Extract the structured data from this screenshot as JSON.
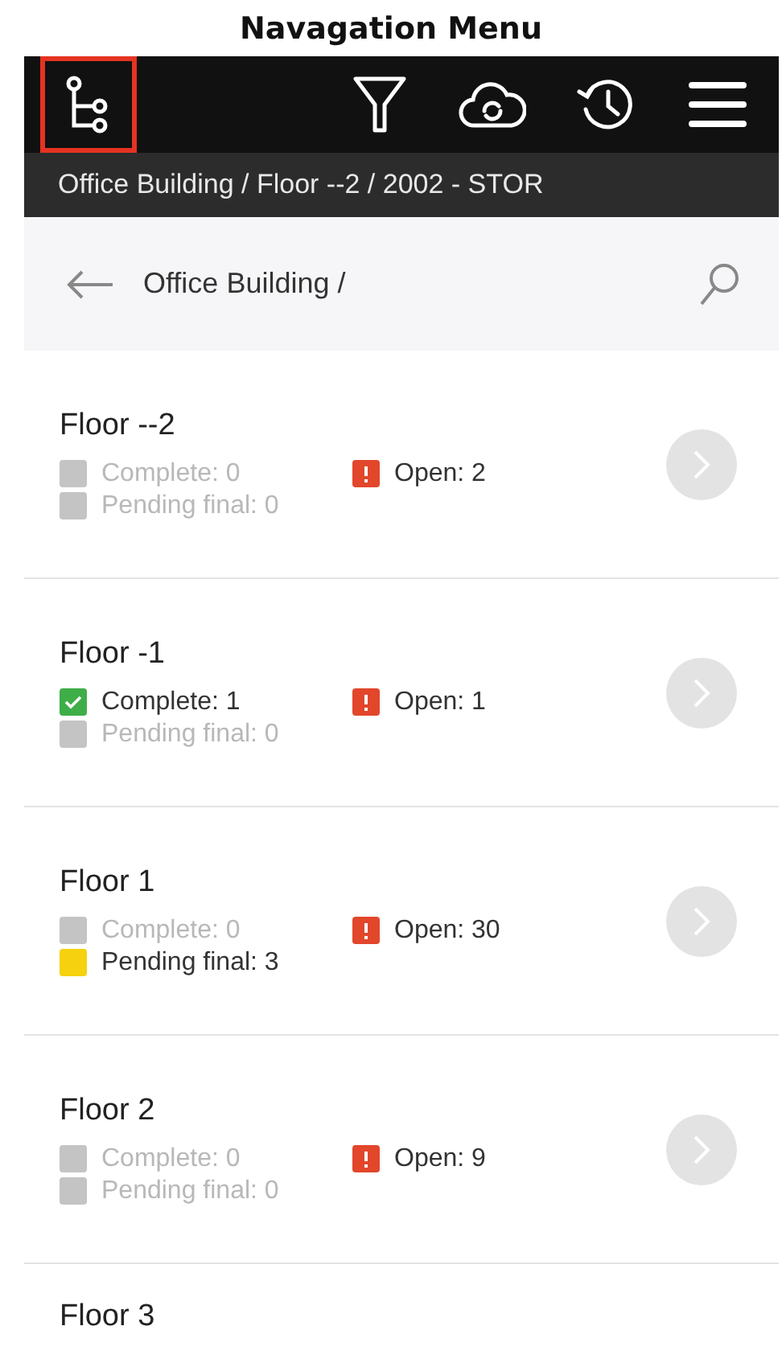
{
  "caption": "Navagation Menu",
  "toolbar": [
    {
      "kind": "tree",
      "highlighted": true
    },
    {
      "kind": "filter",
      "highlighted": false
    },
    {
      "kind": "cloud-sync",
      "highlighted": false
    },
    {
      "kind": "history",
      "highlighted": false
    },
    {
      "kind": "menu",
      "highlighted": false
    }
  ],
  "breadcrumb": "Office Building / Floor --2 / 2002 - STOR",
  "header": {
    "title": "Office Building /"
  },
  "floors": [
    {
      "name": "Floor --2",
      "complete": {
        "label": "Complete: 0",
        "active": false
      },
      "pending": {
        "label": "Pending final: 0",
        "active": false
      },
      "open": {
        "label": "Open: 2"
      }
    },
    {
      "name": "Floor -1",
      "complete": {
        "label": "Complete: 1",
        "active": true
      },
      "pending": {
        "label": "Pending final: 0",
        "active": false
      },
      "open": {
        "label": "Open: 1"
      }
    },
    {
      "name": "Floor 1",
      "complete": {
        "label": "Complete: 0",
        "active": false
      },
      "pending": {
        "label": "Pending final: 3",
        "active": true
      },
      "open": {
        "label": "Open: 30"
      }
    },
    {
      "name": "Floor 2",
      "complete": {
        "label": "Complete: 0",
        "active": false
      },
      "pending": {
        "label": "Pending final: 0",
        "active": false
      },
      "open": {
        "label": "Open: 9"
      }
    },
    {
      "name": "Floor 3"
    }
  ]
}
